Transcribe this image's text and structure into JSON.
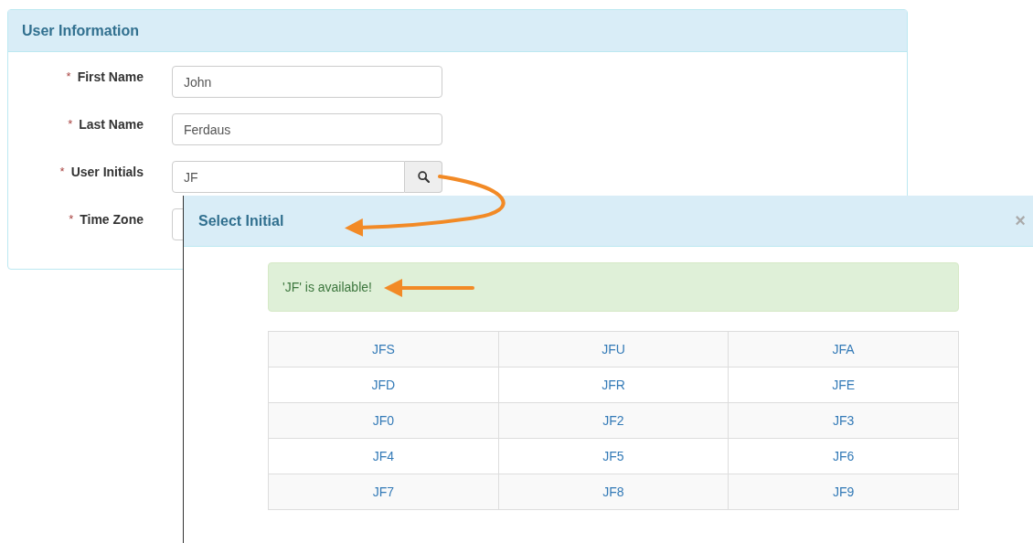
{
  "panel": {
    "title": "User Information",
    "fields": [
      {
        "required_mark": "*",
        "label": "First Name",
        "kind": "text",
        "value": "John"
      },
      {
        "required_mark": "*",
        "label": "Last Name",
        "kind": "text",
        "value": "Ferdaus"
      },
      {
        "required_mark": "*",
        "label": "User Initials",
        "kind": "search",
        "value": "JF"
      },
      {
        "required_mark": "*",
        "label": "Time Zone",
        "kind": "select"
      }
    ]
  },
  "modal": {
    "title": "Select Initial",
    "close": "×",
    "alert": "'JF' is available!",
    "rows": [
      [
        "JFS",
        "JFU",
        "JFA"
      ],
      [
        "JFD",
        "JFR",
        "JFE"
      ],
      [
        "JF0",
        "JF2",
        "JF3"
      ],
      [
        "JF4",
        "JF5",
        "JF6"
      ],
      [
        "JF7",
        "JF8",
        "JF9"
      ]
    ]
  }
}
